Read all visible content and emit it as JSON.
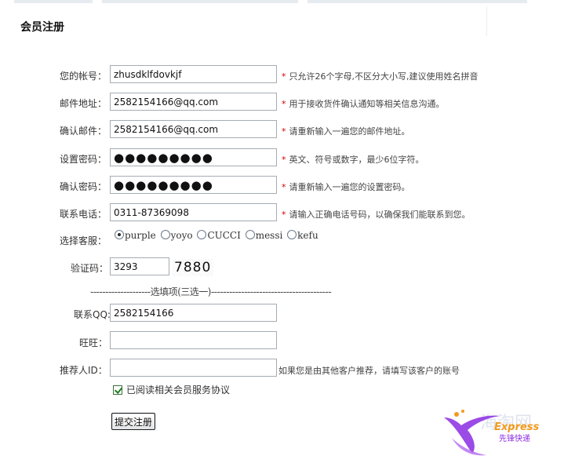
{
  "page_title": "会员注册",
  "form": {
    "account": {
      "label": "您的帐号：",
      "value": "zhusdklfdovkjf",
      "hint": "只允许26个字母,不区分大小写,建议使用姓名拼音"
    },
    "email": {
      "label": "邮件地址：",
      "value": "2582154166@qq.com",
      "hint": "用于接收货件确认通知等相关信息沟通。"
    },
    "email_confirm": {
      "label": "确认邮件：",
      "value": "2582154166@qq.com",
      "hint": "请重新输入一遍您的邮件地址。"
    },
    "password": {
      "label": "设置密码：",
      "value": "●●●●●●●●●",
      "hint": "英文、符号或数字，最少6位字符。"
    },
    "password_confirm": {
      "label": "确认密码：",
      "value": "●●●●●●●●●",
      "hint": "请重新输入一遍您的设置密码。"
    },
    "phone": {
      "label": "联系电话：",
      "value": "0311-87369098",
      "hint": "请输入正确电话号码，以确保我们能联系到您。"
    },
    "service": {
      "label": "选择客服：",
      "options": [
        "purple",
        "yoyo",
        "CUCCI",
        "messi",
        "kefu"
      ],
      "selected": "purple"
    },
    "captcha": {
      "label": "验证码：",
      "value": "3293",
      "image_text": "7880"
    },
    "optional_separator": "--------------------选填项(三选一)----------------------------------------",
    "qq": {
      "label": "联系QQ:",
      "value": "2582154166"
    },
    "wangwang": {
      "label": "旺旺：",
      "value": ""
    },
    "referrer": {
      "label": "推荐人ID：",
      "value": "",
      "hint": "如果您是由其他客户推荐，请填写该客户的账号"
    },
    "agree": {
      "label": "已阅读相关会员服务协议",
      "checked": true
    },
    "submit_label": "提交注册"
  },
  "required_mark": "*",
  "logo": {
    "text": "Express",
    "subtext": "先锋快递",
    "watermark": "海淘网"
  },
  "colors": {
    "required": "#d40000",
    "input_border": "#a5acb5",
    "logo_purple": "#8a2be2",
    "logo_orange": "#f29a1d"
  }
}
